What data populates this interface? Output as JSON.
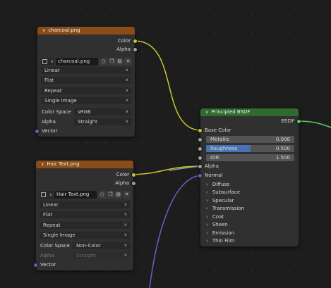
{
  "colors": {
    "texture_header": "#8b4d18",
    "shader_header": "#2f6a2f",
    "socket_color": "#c7c729",
    "socket_float": "#a1a1a1",
    "socket_vector": "#6363c7",
    "socket_shader": "#63c763",
    "slider_fill": "#4772b3"
  },
  "node1": {
    "title": "charcoal.png",
    "outputs": [
      "Color",
      "Alpha"
    ],
    "image_name": "charcoal.png",
    "interpolation": "Linear",
    "projection": "Flat",
    "extension": "Repeat",
    "source": "Single Image",
    "color_space_label": "Color Space",
    "color_space": "sRGB",
    "alpha_label": "Alpha",
    "alpha_mode": "Straight",
    "input": "Vector"
  },
  "node2": {
    "title": "Hair Text.png",
    "outputs": [
      "Color",
      "Alpha"
    ],
    "image_name": "Hair Text.png",
    "interpolation": "Linear",
    "projection": "Flat",
    "extension": "Repeat",
    "source": "Single Image",
    "color_space_label": "Color Space",
    "color_space": "Non-Color",
    "alpha_label": "Alpha",
    "alpha_mode": "Straight",
    "input": "Vector"
  },
  "bsdf": {
    "title": "Principled BSDF",
    "output": "BSDF",
    "base_color": "Base Color",
    "metallic_label": "Metallic",
    "metallic_value": "0.000",
    "roughness_label": "Roughness",
    "roughness_value": "0.500",
    "roughness_fraction": 0.5,
    "ior_label": "IOR",
    "ior_value": "1.500",
    "alpha": "Alpha",
    "normal": "Normal",
    "panels": [
      "Diffuse",
      "Subsurface",
      "Specular",
      "Transmission",
      "Coat",
      "Sheen",
      "Emission",
      "Thin Film"
    ]
  }
}
